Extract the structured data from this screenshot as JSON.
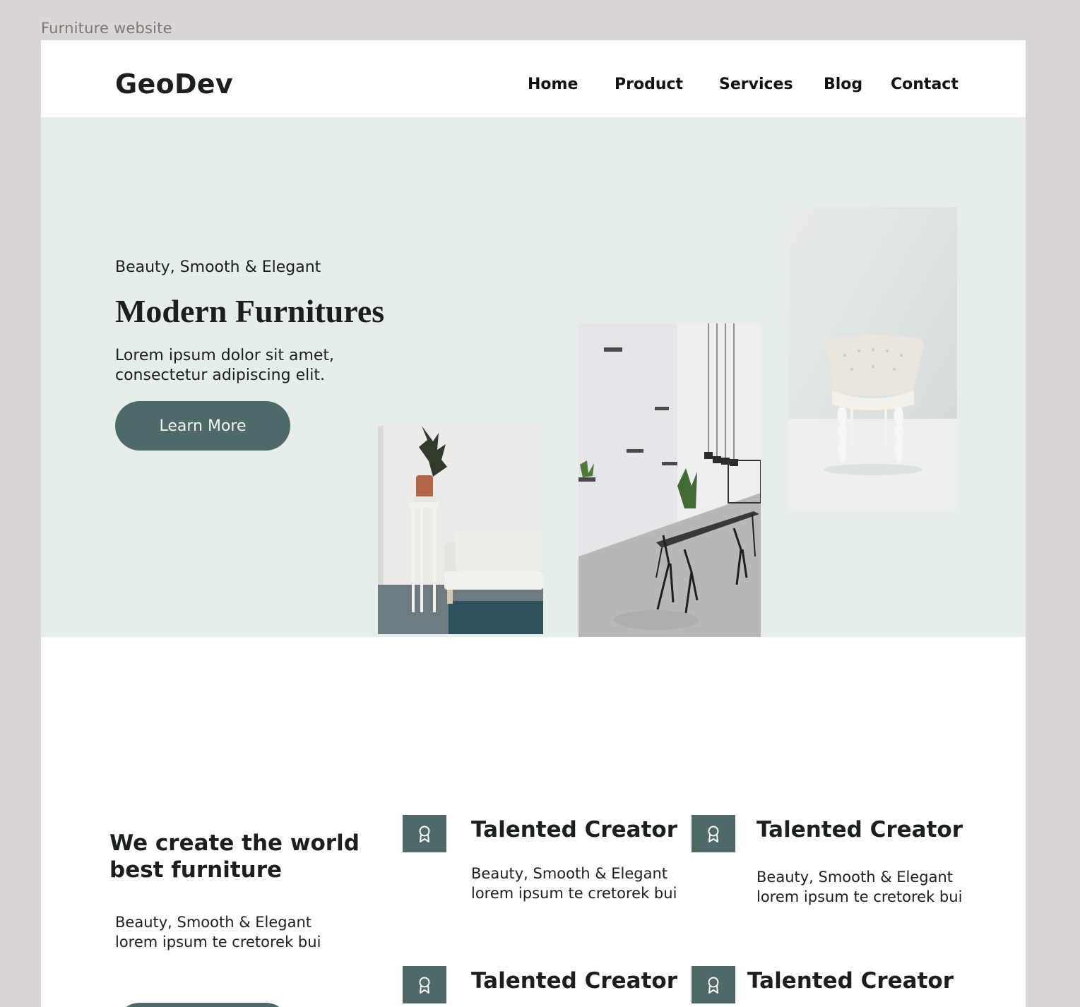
{
  "frame_label": "Furniture  website",
  "header": {
    "logo": "GeoDev",
    "nav": [
      "Home",
      "Product",
      "Services",
      "Blog",
      "Contact"
    ]
  },
  "hero": {
    "tagline": "Beauty, Smooth & Elegant",
    "title": "Modern Furnitures",
    "description": "Lorem ipsum dolor sit amet, consectetur adipiscing elit.",
    "cta_label": "Learn More"
  },
  "features": {
    "heading": "We create the world best furniture",
    "tagline": "Beauty, Smooth & Elegant",
    "description": "lorem ipsum te cretorek bui",
    "cards": [
      {
        "title": "Talented Creator",
        "tagline": "Beauty, Smooth & Elegant",
        "description": "lorem ipsum te cretorek bui",
        "icon": "award-icon"
      },
      {
        "title": "Talented Creator",
        "tagline": "Beauty, Smooth & Elegant",
        "description": "lorem ipsum te cretorek bui",
        "icon": "award-icon"
      },
      {
        "title": "Talented Creator",
        "icon": "award-icon"
      },
      {
        "title": "Talented Creator",
        "icon": "award-icon"
      }
    ]
  },
  "colors": {
    "accent": "#4e6967",
    "hero_bg": "#e5eeeb",
    "canvas_bg": "#dbd7d6",
    "text": "#1b1f1e"
  }
}
